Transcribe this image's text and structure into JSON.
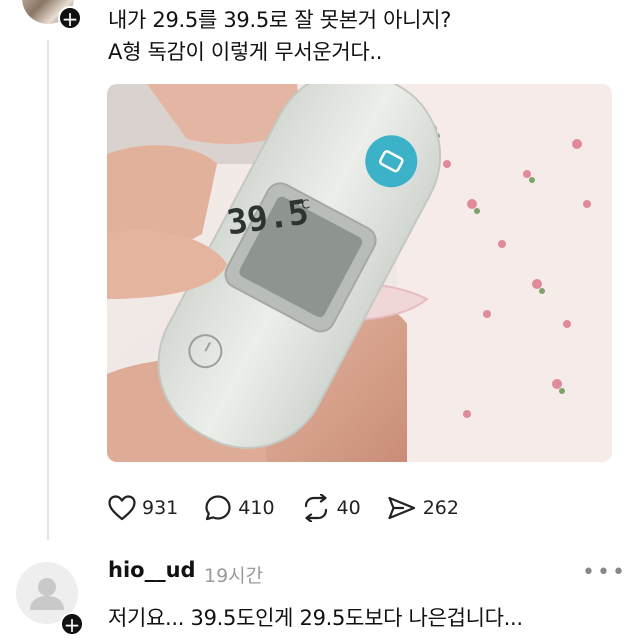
{
  "post": {
    "line1": "내가 29.5를 39.5로 잘 못본거 아니지?",
    "line2": "A형 독감이 이렇게 무서운거다..",
    "thermometer_display": "39.5",
    "thermometer_unit": "°C"
  },
  "actions": {
    "likes": "931",
    "comments": "410",
    "reposts": "40",
    "shares": "262"
  },
  "reply": {
    "username": "hio__ud",
    "time": "19시간",
    "more": "•••",
    "text": "저기요... 39.5도인게 29.5도보다 나은겁니다..."
  },
  "badge_symbol": "+",
  "colors": {
    "thermo_button": "#3cb2c9",
    "thermo_body": "#e6e9e4",
    "lcd": "#8e958f"
  }
}
